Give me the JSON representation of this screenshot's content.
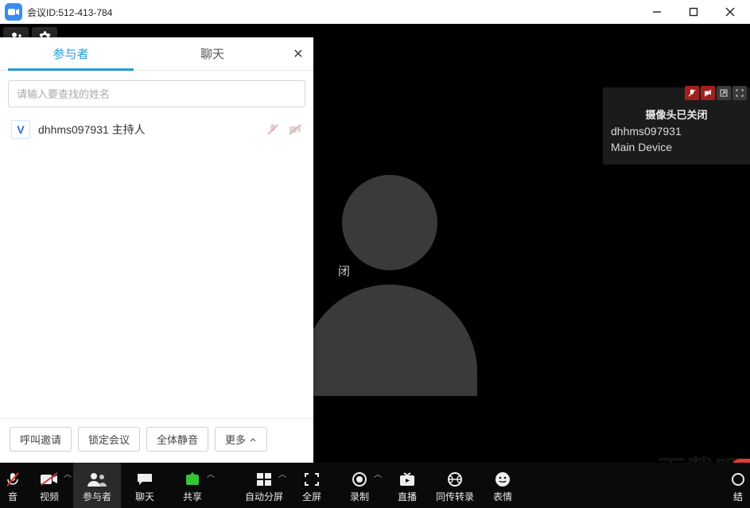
{
  "titlebar": {
    "prefix": "会议ID:",
    "meeting_id": "512-413-784"
  },
  "panel": {
    "tabs": {
      "participants": "参与者",
      "chat": "聊天"
    },
    "search_placeholder": "请输入要查找的姓名",
    "participants": [
      {
        "avatar_letter": "V",
        "name": "dhhms097931 主持人"
      }
    ],
    "actions": {
      "invite": "呼叫邀请",
      "lock": "锁定会议",
      "mute_all": "全体静音",
      "more": "更多"
    }
  },
  "main_video": {
    "center_badge": "闭"
  },
  "tile": {
    "camera_off": "摄像头已关闭",
    "user": "dhhms097931",
    "device": "Main Device"
  },
  "bottom": {
    "audio": "音",
    "video": "视频",
    "participants": "参与者",
    "chat": "聊天",
    "share": "共享",
    "auto_split": "自动分屏",
    "fullscreen": "全屏",
    "record": "录制",
    "live": "直播",
    "transcribe": "同传转录",
    "emoji": "表情",
    "end_partial": "结"
  },
  "watermark": "下载吧"
}
